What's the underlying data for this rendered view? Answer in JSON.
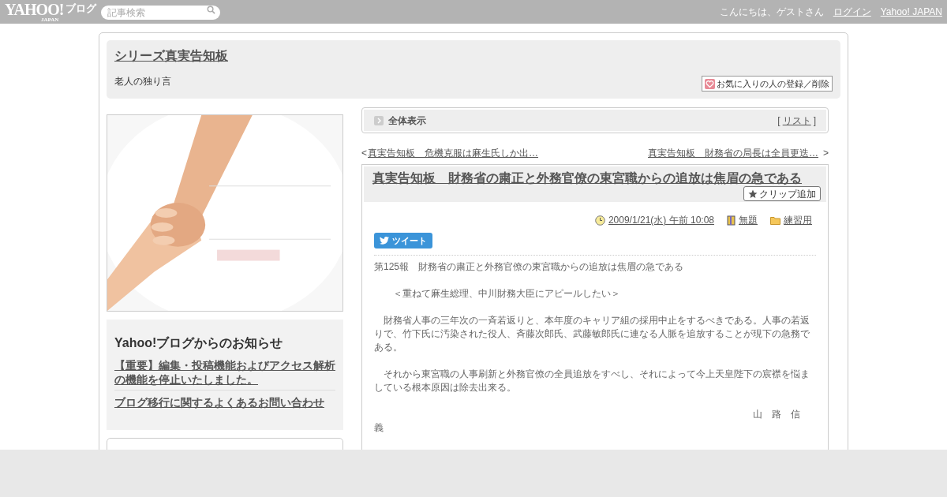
{
  "top_bar": {
    "logo": "YAHOO!",
    "logo_sub": "JAPAN",
    "service": "ブログ",
    "search": {
      "placeholder": "記事検索"
    },
    "greeting": "こんにちは、ゲストさん",
    "links": [
      "ログイン",
      "Yahoo! JAPAN"
    ]
  },
  "blog_header": {
    "title": "シリーズ真実告知板",
    "description": "老人の独り言",
    "favorite_button": "お気に入りの人の登録／削除"
  },
  "sidebar": {
    "notice": {
      "title": "Yahoo!ブログからのお知らせ",
      "links": [
        "【重要】編集・投稿機能およびアクセス解析の機能を停止いたしました。",
        "ブログ移行に関するよくあるお問い合わせ"
      ]
    }
  },
  "view_bar": {
    "label": "全体表示",
    "list_open": "[",
    "list_link": "リスト",
    "list_close": "]"
  },
  "article_nav": {
    "prev_mark": "<",
    "prev": "真実告知板　危機克服は麻生氏しか出…",
    "next": "真実告知板　財務省の局長は全員更迭…",
    "next_mark": ">"
  },
  "article": {
    "title": "真実告知板　財務省の粛正と外務官僚の東宮職からの追放は焦眉の急である",
    "clip_button": "クリップ追加",
    "date": "2009/1/21(水) 午前 10:08",
    "theme": "無題",
    "category": "練習用",
    "tweet_button": "ツイート",
    "paragraphs": [
      {
        "kind": "plain",
        "text": "第125報　財務省の粛正と外務官僚の東宮職からの追放は焦眉の急である"
      },
      {
        "kind": "indented",
        "text": "＜重ねて麻生総理、中川財務大臣にアピールしたい＞"
      },
      {
        "kind": "plain",
        "text": "　財務省人事の三年次の一斉若返りと、本年度のキャリア組の採用中止をするべきである。人事の若返りで、竹下氏に汚染された役人、斉藤次郎氏、武藤敏郎氏に連なる人脈を追放することが現下の急務である。"
      },
      {
        "kind": "plain",
        "text": "　それから東宮職の人事刷新と外務官僚の全員追放をすべし、それによって今上天皇陛下の宸襟を悩ましている根本原因は除去出来る。"
      },
      {
        "kind": "signature",
        "text": "山　路　信義"
      }
    ]
  }
}
